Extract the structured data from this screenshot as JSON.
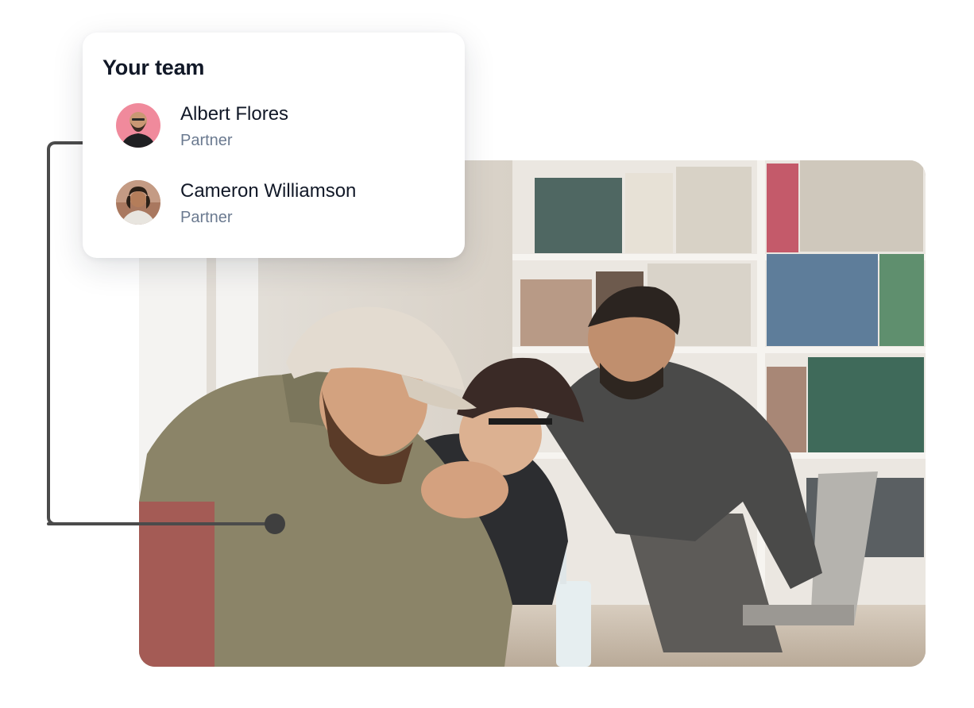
{
  "team_card": {
    "title": "Your team",
    "members": [
      {
        "name": "Albert Flores",
        "role": "Partner",
        "avatar_icon": "person-avatar-pink"
      },
      {
        "name": "Cameron Williamson",
        "role": "Partner",
        "avatar_icon": "person-avatar-brick"
      }
    ]
  },
  "photo": {
    "subject_icon": "team-photo-library"
  },
  "colors": {
    "card_title": "#111827",
    "role_text": "#6b7a90",
    "connector": "#4b4b4b"
  }
}
